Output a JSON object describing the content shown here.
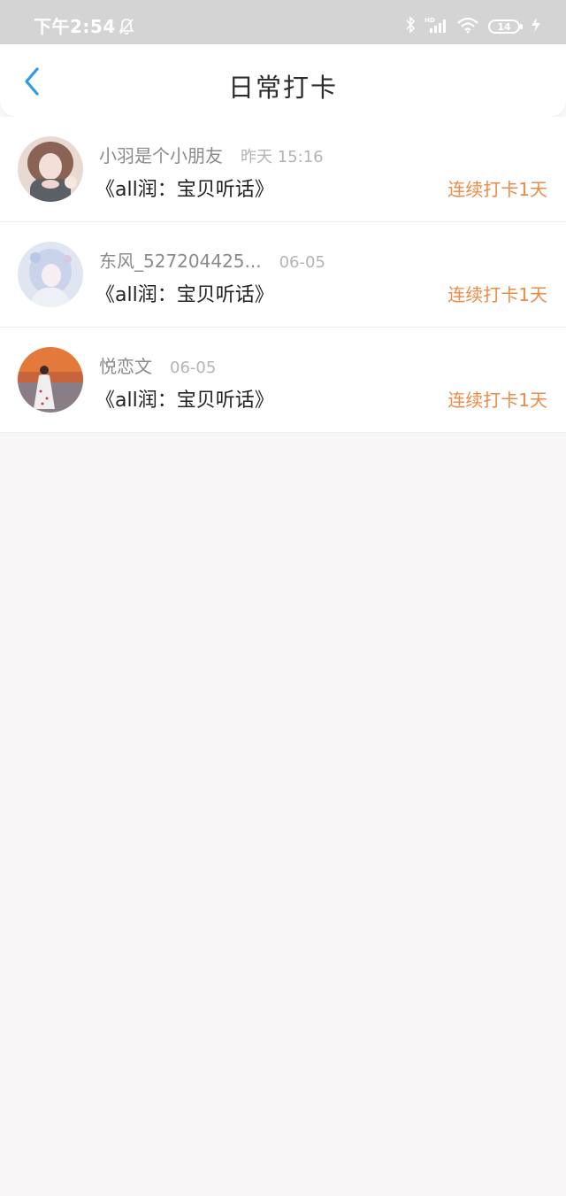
{
  "status_bar": {
    "time": "下午2:54",
    "battery": "14",
    "icons": [
      "bell-muted-icon",
      "bluetooth-icon",
      "hd-signal-icon",
      "wifi-icon",
      "battery-icon",
      "charging-icon"
    ]
  },
  "header": {
    "title": "日常打卡",
    "back_icon": "chevron-left-icon",
    "accent_color": "#2e9be8"
  },
  "checkins": [
    {
      "user": "小羽是个小朋友",
      "time": "昨天 15:16",
      "book": "《all润：宝贝听话》",
      "streak": "连续打卡1天"
    },
    {
      "user": "东风_527204425...",
      "time": "06-05",
      "book": "《all润：宝贝听话》",
      "streak": "连续打卡1天"
    },
    {
      "user": "悦恋文",
      "time": "06-05",
      "book": "《all润：宝贝听话》",
      "streak": "连续打卡1天"
    }
  ],
  "colors": {
    "streak": "#ee8a45",
    "status_bar": "#d4d4d4",
    "background": "#f8f6f7"
  }
}
